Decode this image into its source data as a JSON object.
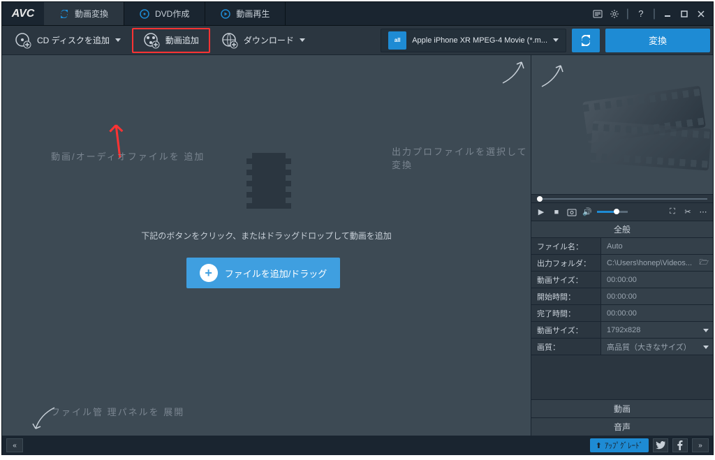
{
  "app": {
    "logo": "AVC"
  },
  "tabs": {
    "convert": "動画変換",
    "dvd": "DVD作成",
    "play": "動画再生"
  },
  "toolbar": {
    "add_cd": "CD ディスクを追加",
    "add_video": "動画追加",
    "download": "ダウンロード",
    "profile": "Apple iPhone XR MPEG-4 Movie (*.m...",
    "convert_btn": "変換"
  },
  "hints": {
    "add_file": "動画/オーディオファイルを 追加",
    "profile_select": "出力プロファイルを選択して変換",
    "expand_panel": "ファイル管 理パネルを 展開",
    "center": "下記のボタンをクリック、またはドラッグドロップして動画を追加",
    "add_btn": "ファイルを追加/ドラッグ"
  },
  "props": {
    "header": "全般",
    "filename_label": "ファイル名：",
    "filename_value": "Auto",
    "output_label": "出力フォルダ：",
    "output_value": "C:\\Users\\honep\\Videos...",
    "vidsize_label": "動画サイズ：",
    "vidsize_value": "00:00:00",
    "start_label": "開始時間：",
    "start_value": "00:00:00",
    "end_label": "完了時間：",
    "end_value": "00:00:00",
    "dim_label": "動画サイズ：",
    "dim_value": "1792x828",
    "quality_label": "画質：",
    "quality_value": "高品質（大きなサイズ）"
  },
  "sections": {
    "video": "動画",
    "audio": "音声"
  },
  "status": {
    "collapse": "«",
    "expand": "»",
    "upgrade": "ｱｯﾌﾟｸﾞﾚｰﾄﾞ"
  }
}
